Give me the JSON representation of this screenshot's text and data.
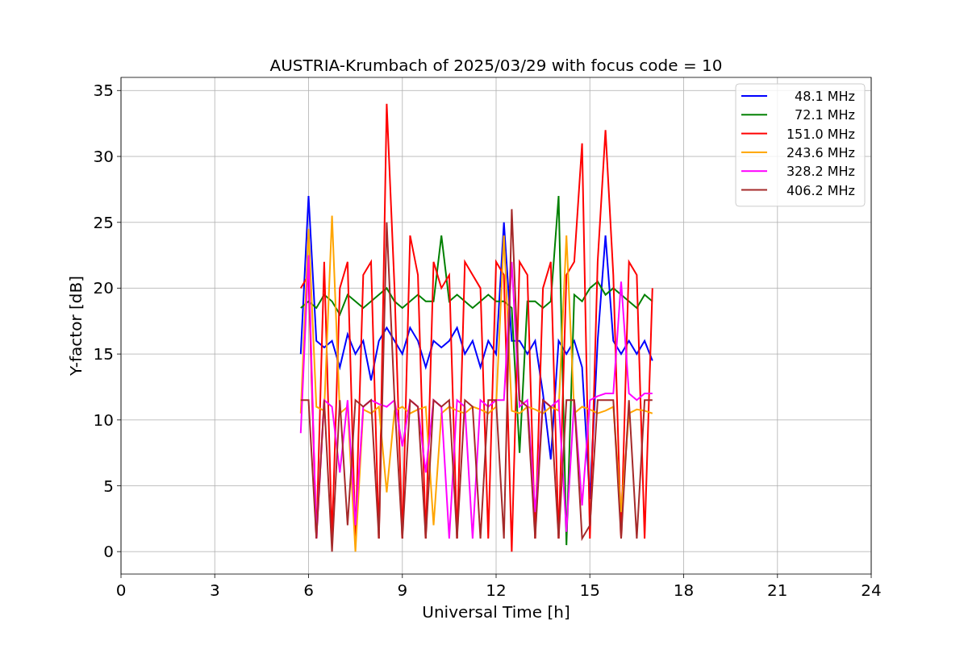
{
  "chart_data": {
    "type": "line",
    "title": "AUSTRIA-Krumbach of 2025/03/29 with focus code = 10",
    "xlabel": "Universal Time [h]",
    "ylabel": "Y-factor [dB]",
    "xlim": [
      0,
      24
    ],
    "ylim": [
      -1.7,
      36
    ],
    "xticks": [
      0,
      3,
      6,
      9,
      12,
      15,
      18,
      21,
      24
    ],
    "yticks": [
      0,
      5,
      10,
      15,
      20,
      25,
      30,
      35
    ],
    "grid": true,
    "legend": true,
    "x": [
      5.75,
      6,
      6.25,
      6.5,
      6.75,
      7,
      7.25,
      7.5,
      7.75,
      8,
      8.25,
      8.5,
      8.75,
      9,
      9.25,
      9.5,
      9.75,
      10,
      10.25,
      10.5,
      10.75,
      11,
      11.25,
      11.5,
      11.75,
      12,
      12.25,
      12.5,
      12.75,
      13,
      13.25,
      13.5,
      13.75,
      14,
      14.25,
      14.5,
      14.75,
      15,
      15.25,
      15.5,
      15.75,
      16,
      16.25,
      16.5,
      16.75,
      17
    ],
    "series": [
      {
        "name": "48.1 MHz",
        "color": "#0000ff",
        "values": [
          15,
          27,
          16,
          15.5,
          16,
          14,
          16.5,
          15,
          16,
          13,
          16,
          17,
          16,
          15,
          17,
          16,
          14,
          16,
          15.5,
          16,
          17,
          15,
          16,
          14,
          16,
          15,
          25,
          16,
          16,
          15,
          16,
          12,
          7,
          16,
          15,
          16,
          14,
          4,
          16,
          24,
          16,
          15,
          16,
          15,
          16,
          14.5
        ]
      },
      {
        "name": "72.1 MHz",
        "color": "#008000",
        "values": [
          18.5,
          19,
          18.5,
          19.5,
          19,
          18,
          19.5,
          19,
          18.5,
          19,
          19.5,
          20,
          19,
          18.5,
          19,
          19.5,
          19,
          19,
          24,
          19,
          19.5,
          19,
          18.5,
          19,
          19.5,
          19,
          19,
          18.5,
          7.5,
          19,
          19,
          18.5,
          19,
          27,
          0.5,
          19.5,
          19,
          20,
          20.5,
          19.5,
          20,
          19.5,
          19,
          18.5,
          19.5,
          19
        ]
      },
      {
        "name": "151.0 MHz",
        "color": "#ff0000",
        "values": [
          20,
          21,
          1,
          22,
          1,
          20,
          22,
          1,
          21,
          22,
          1,
          34,
          20,
          1,
          24,
          21,
          1,
          22,
          20,
          21,
          1,
          22,
          21,
          20,
          1,
          22,
          21,
          0,
          22,
          21,
          1,
          20,
          22,
          1,
          21,
          22,
          31,
          1,
          22,
          32,
          21,
          1,
          22,
          21,
          1,
          20
        ]
      },
      {
        "name": "243.6 MHz",
        "color": "#ffa500",
        "values": [
          10.5,
          24.5,
          11,
          10.7,
          25.5,
          10.5,
          11,
          0,
          10.8,
          10.5,
          11,
          4.5,
          10.7,
          11,
          10.5,
          10.8,
          11,
          2,
          10.5,
          11,
          10.7,
          10.5,
          11,
          10.8,
          10.5,
          11,
          24,
          10.7,
          10.5,
          11,
          10.8,
          10.5,
          11,
          10.7,
          24,
          10.5,
          11,
          10.8,
          10.5,
          10.7,
          11,
          3,
          10.5,
          10.8,
          10.7,
          10.5
        ]
      },
      {
        "name": "328.2 MHz",
        "color": "#ff00ff",
        "values": [
          9,
          22.5,
          1,
          11.5,
          11,
          6,
          11.5,
          2,
          11,
          11.5,
          11.2,
          11,
          11.5,
          8,
          11.5,
          11,
          6,
          11.5,
          11,
          1,
          11.5,
          11,
          1,
          11.5,
          11,
          11.5,
          11.5,
          22,
          11,
          11.5,
          3,
          11.5,
          11,
          11.5,
          1.5,
          11.5,
          3.5,
          11.5,
          11.8,
          12,
          12,
          20.5,
          12,
          11.5,
          12,
          12
        ]
      },
      {
        "name": "406.2 MHz",
        "color": "#a52a2a",
        "values": [
          11.5,
          11.5,
          1,
          11.5,
          0,
          11.5,
          2,
          11.5,
          11,
          11.5,
          1,
          25,
          11.5,
          1,
          11.5,
          11,
          1,
          11.5,
          11,
          11.5,
          1,
          11.5,
          11,
          1,
          11.5,
          11.5,
          1,
          26,
          11.5,
          11,
          1,
          11.5,
          11,
          1,
          11.5,
          11.5,
          1,
          2,
          11.5,
          11.5,
          11.5,
          1,
          11.5,
          1,
          11.5,
          11.5
        ]
      }
    ]
  }
}
